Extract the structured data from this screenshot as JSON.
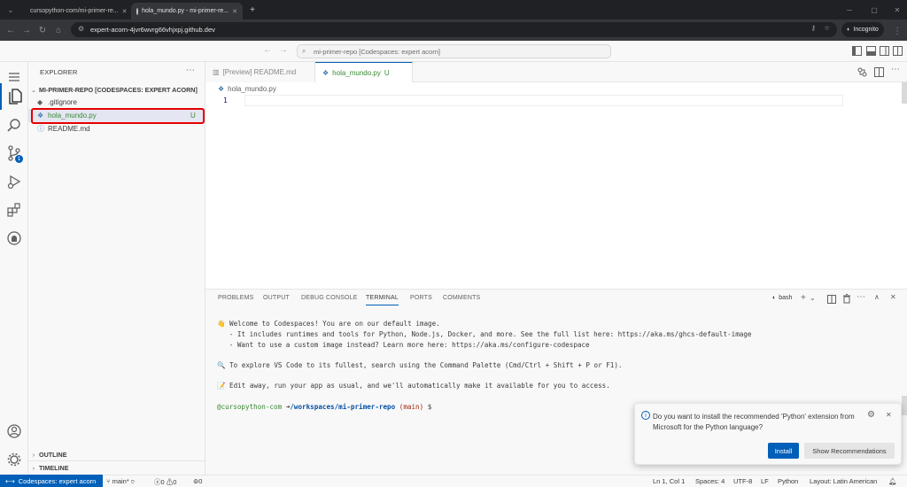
{
  "browser": {
    "tabs": [
      {
        "title": "cursopython-com/mi-primer-re..."
      },
      {
        "title": "hola_mundo.py - mi-primer-re..."
      }
    ],
    "url": "expert-acorn-4jvr6wvrg66vhjxpj.github.dev",
    "incognito_label": "Incognito"
  },
  "vscode": {
    "command_center": "mi-primer-repo [Codespaces: expert acorn]"
  },
  "explorer": {
    "title": "EXPLORER",
    "root": "MI-PRIMER-REPO [CODESPACES: EXPERT ACORN]",
    "files": [
      {
        "name": ".gitignore",
        "badge": ""
      },
      {
        "name": "hola_mundo.py",
        "badge": "U"
      },
      {
        "name": "README.md",
        "badge": ""
      }
    ],
    "outline": "OUTLINE",
    "timeline": "TIMELINE"
  },
  "editor": {
    "tabs": [
      {
        "label": "[Preview] README.md",
        "badge": ""
      },
      {
        "label": "hola_mundo.py",
        "badge": "U"
      }
    ],
    "breadcrumb": "hola_mundo.py",
    "line_number": "1"
  },
  "panel": {
    "tabs": [
      "PROBLEMS",
      "OUTPUT",
      "DEBUG CONSOLE",
      "TERMINAL",
      "PORTS",
      "COMMENTS"
    ],
    "active_tab": "TERMINAL",
    "shell": "bash",
    "terminal": {
      "line1": "👋 Welcome to Codespaces! You are on our default image.",
      "line2": "   - It includes runtimes and tools for Python, Node.js, Docker, and more. See the full list here: https://aka.ms/ghcs-default-image",
      "line3": "   - Want to use a custom image instead? Learn more here: https://aka.ms/configure-codespace",
      "line4": "🔍 To explore VS Code to its fullest, search using the Command Palette (Cmd/Ctrl + Shift + P or F1).",
      "line5": "📝 Edit away, run your app as usual, and we'll automatically make it available for you to access.",
      "prompt_user": "@cursopython-com",
      "prompt_arrow": "➜",
      "prompt_path": "/workspaces/mi-primer-repo",
      "prompt_branch": "(main)",
      "prompt_symbol": "$"
    }
  },
  "notification": {
    "message": "Do you want to install the recommended 'Python' extension from Microsoft for the Python language?",
    "install_label": "Install",
    "show_label": "Show Recommendations"
  },
  "statusbar": {
    "remote": "Codespaces: expert acorn",
    "branch": "main*",
    "errors": "0",
    "warnings": "0",
    "ports": "0",
    "position": "Ln 1, Col 1",
    "spaces": "Spaces: 4",
    "encoding": "UTF-8",
    "eol": "LF",
    "language": "Python",
    "layout": "Layout: Latin American"
  },
  "colors": {
    "accent": "#005fb8",
    "highlight": "#e60000",
    "untracked": "#388a34"
  }
}
